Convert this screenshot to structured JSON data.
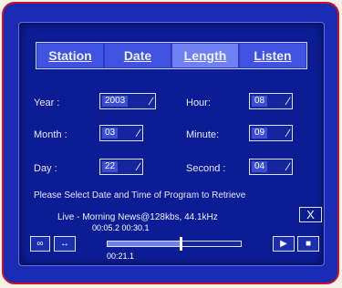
{
  "tabs": [
    {
      "label": "Station"
    },
    {
      "label": "Date"
    },
    {
      "label": "Length"
    },
    {
      "label": "Listen"
    }
  ],
  "fields": {
    "year": {
      "label": "Year :",
      "value": "2003"
    },
    "month": {
      "label": "Month :",
      "value": "03"
    },
    "day": {
      "label": "Day :",
      "value": "22"
    },
    "hour": {
      "label": "Hour:",
      "value": "08"
    },
    "minute": {
      "label": "Minute:",
      "value": "09"
    },
    "second": {
      "label": "Second :",
      "value": "04"
    }
  },
  "notice": "Please Select Date and Time of Program to Retrieve",
  "status": "Live - Morning News@128kbs, 44.1kHz",
  "close_label": "X",
  "times": {
    "range": "00:05.2  00:30.1",
    "current": "00:21.1"
  },
  "progress": 0.55,
  "controls": {
    "link_label": "∞",
    "loop_label": "↔",
    "play_label": "▶",
    "stop_label": "■"
  },
  "colors": {
    "frame": "#1a2bb4",
    "border": "#c8102e",
    "screen": "#0c1c95",
    "active_tab": "#6f80f2"
  }
}
